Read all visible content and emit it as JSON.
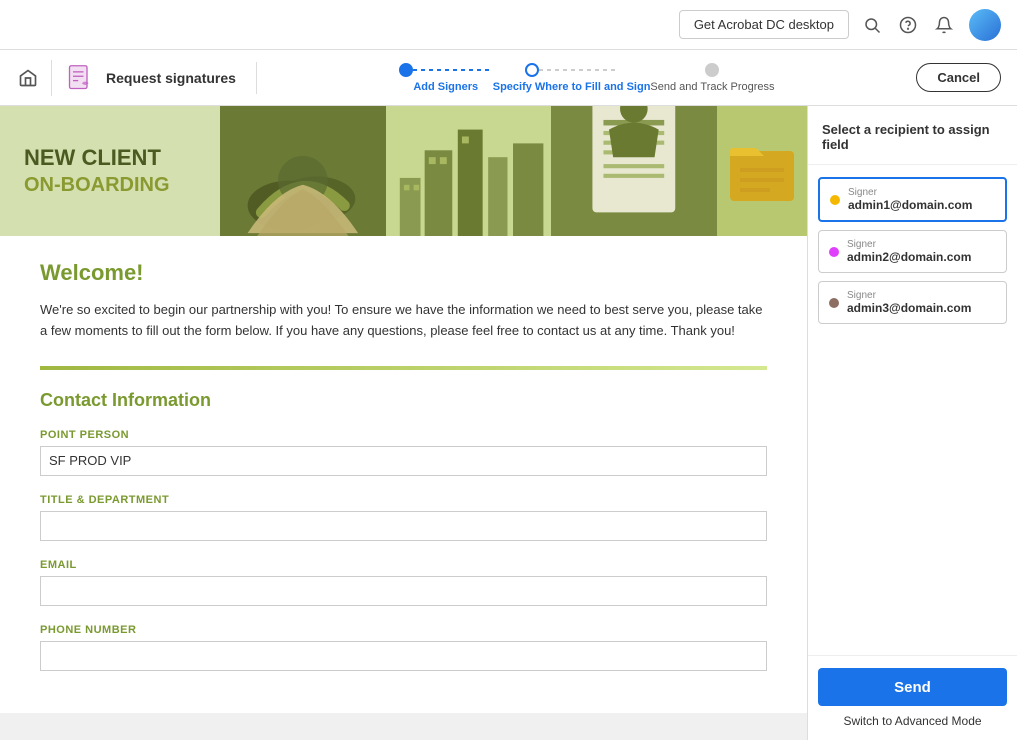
{
  "topbar": {
    "acrobat_btn": "Get Acrobat DC desktop",
    "search_icon": "search-icon",
    "help_icon": "help-icon",
    "bell_icon": "bell-icon"
  },
  "navbar": {
    "home_icon": "home-icon",
    "request_signatures_label": "Request signatures",
    "cancel_label": "Cancel"
  },
  "progress": {
    "step1_label": "Add Signers",
    "step2_label": "Specify Where to Fill and Sign",
    "step3_label": "Send and Track Progress"
  },
  "right_panel": {
    "title": "Select a recipient to assign field",
    "send_label": "Send",
    "advanced_mode_label": "Switch to Advanced Mode",
    "signers": [
      {
        "role": "Signer",
        "email": "admin1@domain.com",
        "dot_color": "#f5b800",
        "selected": true
      },
      {
        "role": "Signer",
        "email": "admin2@domain.com",
        "dot_color": "#e040fb",
        "selected": false
      },
      {
        "role": "Signer",
        "email": "admin3@domain.com",
        "dot_color": "#8d6e63",
        "selected": false
      }
    ]
  },
  "document": {
    "banner_title_line1": "NEW CLIENT",
    "banner_title_line2": "ON-BOARDING",
    "welcome_heading": "Welcome!",
    "welcome_body": "We're so excited to begin our partnership with you! To ensure we have the information we need to best serve you, please take a few moments to fill out the form below. If you have any questions, please feel free to contact us at any time. Thank you!",
    "contact_section_title": "Contact Information",
    "fields": [
      {
        "label": "POINT PERSON",
        "value": "SF PROD VIP",
        "placeholder": ""
      },
      {
        "label": "TITLE & DEPARTMENT",
        "value": "",
        "placeholder": ""
      },
      {
        "label": "EMAIL",
        "value": "",
        "placeholder": ""
      },
      {
        "label": "PHONE NUMBER",
        "value": "",
        "placeholder": ""
      }
    ]
  }
}
